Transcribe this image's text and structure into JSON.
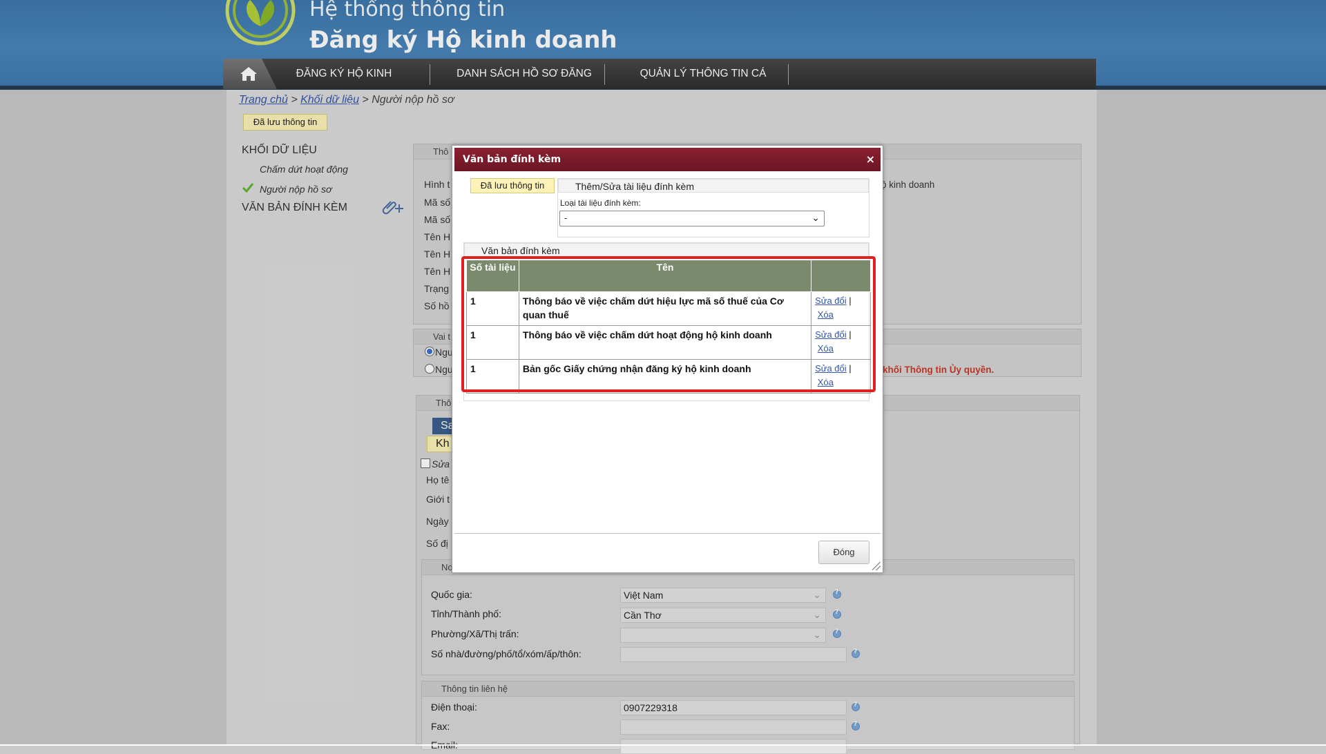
{
  "header": {
    "title_line1": "Hệ thống thông tin",
    "title_line2": "Đăng ký Hộ kinh doanh",
    "nav": [
      {
        "label": "ĐĂNG KÝ HỘ KINH DOANH"
      },
      {
        "label": "DANH SÁCH HỒ SƠ ĐĂNG KÝ"
      },
      {
        "label": "QUẢN LÝ THÔNG TIN CÁ NHÂN"
      }
    ]
  },
  "breadcrumb": {
    "home": "Trang chủ",
    "sep1": ">",
    "data": "Khối dữ liệu",
    "sep2": ">",
    "current": "Người nộp hồ sơ"
  },
  "saved_badge": "Đã lưu thông tin",
  "sidebar": {
    "section1_title": "KHỐI DỮ LIỆU",
    "items": [
      {
        "label": "Chấm dứt hoạt động"
      },
      {
        "label": "Người nộp hồ sơ"
      }
    ],
    "section2_title": "VĂN BẢN ĐÍNH KÈM"
  },
  "background_form": {
    "panel1_head": "Thô",
    "row_labels": [
      "Hình t",
      "Mã số",
      "Mã số",
      "Tên H",
      "Tên H",
      "Tên H",
      "Trạng",
      "Số hồ"
    ],
    "right_text": "ộ kinh doanh",
    "panel2_head": "Vai t",
    "radio1": "Ngư",
    "radio2": "Ngư",
    "red_note": "khối Thông tin Ủy quyền.",
    "panel3_head": "Thô",
    "btn_sa": "Sa",
    "btn_kh": "Kh",
    "check_label": "Sửa",
    "p3_labels": [
      "Họ tê",
      "Giới t",
      "Ngày",
      "Số đị"
    ],
    "panel4_head": "No",
    "address": {
      "country_label": "Quốc gia:",
      "country_value": "Việt Nam",
      "city_label": "Tỉnh/Thành phố:",
      "city_value": "Cần Thơ",
      "ward_label": "Phường/Xã/Thị trấn:",
      "ward_value": "",
      "street_label": "Số nhà/đường/phố/tổ/xóm/ấp/thôn:",
      "street_value": ""
    },
    "contact_head": "Thông tin liên hệ",
    "phone_label": "Điện thoại:",
    "phone_value": "0907229318",
    "fax_label": "Fax:",
    "fax_value": "",
    "email_label": "Email:"
  },
  "modal": {
    "title": "Văn bản đính kèm",
    "close_symbol": "×",
    "saved_tab": "Đã lưu thông tin",
    "add_legend": "Thêm/Sửa tài liệu đính kèm",
    "type_label": "Loại tài liệu đính kèm:",
    "type_value": "-",
    "list_legend": "Văn bản đính kèm",
    "columns": [
      "Số tài liệu",
      "Tên",
      ""
    ],
    "rows": [
      {
        "num": "1",
        "name": "Thông báo về việc chấm dứt hiệu lực mã số thuế của Cơ quan thuế",
        "edit": "Sửa đổi",
        "sep": "|",
        "delete": "Xóa"
      },
      {
        "num": "1",
        "name": "Thông báo về việc chấm dứt hoạt động hộ kinh doanh",
        "edit": "Sửa đổi",
        "sep": "|",
        "delete": "Xóa"
      },
      {
        "num": "1",
        "name": "Bản gốc Giấy chứng nhận đăng ký hộ kinh doanh",
        "edit": "Sửa đổi",
        "sep": "|",
        "delete": "Xóa"
      }
    ],
    "close_button": "Đóng"
  },
  "colors": {
    "header_blue": "#4a86bb",
    "modal_title": "#7a1b2a",
    "table_header": "#7b8a6c",
    "highlight": "#e02020"
  }
}
